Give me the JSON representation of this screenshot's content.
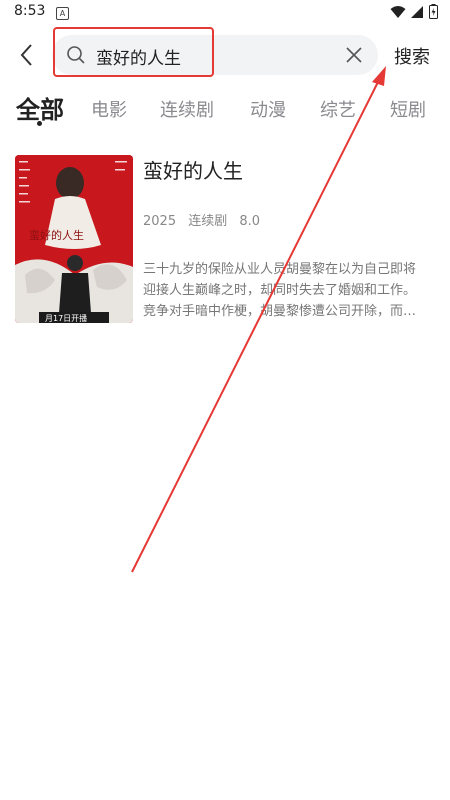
{
  "status": {
    "time": "8:53",
    "notif_icon": "A"
  },
  "search": {
    "value": "蛮好的人生",
    "button_label": "搜索"
  },
  "tabs": [
    {
      "label": "全部",
      "active": true
    },
    {
      "label": "电影"
    },
    {
      "label": "连续剧"
    },
    {
      "label": "动漫"
    },
    {
      "label": "综艺"
    },
    {
      "label": "短剧"
    }
  ],
  "result": {
    "title": "蛮好的人生",
    "year": "2025",
    "type": "连续剧",
    "score": "8.0",
    "description": "三十九岁的保险从业人员胡曼黎在以为自己即将迎接人生巅峰之时，却同时失去了婚姻和工作。竞争对手暗中作梗，胡曼黎惨遭公司开除，而始作俑者竟是二十八岁的薛晓…",
    "poster": {
      "title": "蛮好的人生",
      "date": "月17日开播"
    }
  },
  "colors": {
    "accent_red": "#e53935",
    "poster_red": "#c8171d"
  }
}
